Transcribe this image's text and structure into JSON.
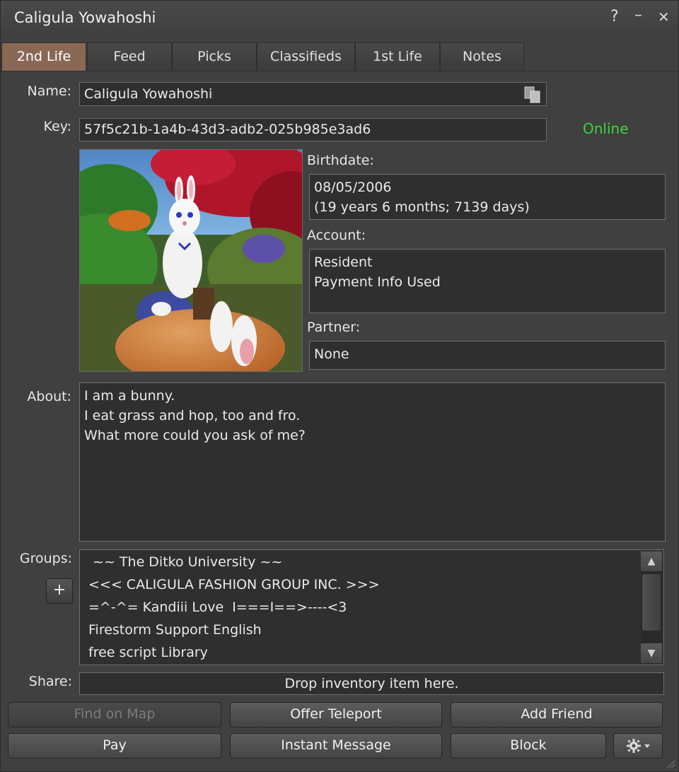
{
  "window": {
    "title": "Caligula Yowahoshi",
    "help": "?",
    "minimize": "–",
    "close": "✕"
  },
  "tabs": [
    {
      "label": "2nd Life",
      "active": true
    },
    {
      "label": "Feed"
    },
    {
      "label": "Picks"
    },
    {
      "label": "Classifieds"
    },
    {
      "label": "1st Life"
    },
    {
      "label": "Notes"
    }
  ],
  "profile": {
    "name_label": "Name:",
    "name": "Caligula Yowahoshi",
    "key_label": "Key:",
    "key": "57f5c21b-1a4b-43d3-adb2-025b985e3ad6",
    "status": "Online",
    "status_color": "#3ad63a",
    "birthdate_label": "Birthdate:",
    "birthdate": "08/05/2006",
    "birthdate_detail": "(19 years 6 months; 7139 days)",
    "account_label": "Account:",
    "account_type": "Resident",
    "account_payment": "Payment Info Used",
    "partner_label": "Partner:",
    "partner": "None",
    "about_label": "About:",
    "about_lines": [
      "I am a bunny.",
      "I eat grass and hop, too and fro.",
      "What more could you ask of me?"
    ],
    "groups_label": "Groups:",
    "groups": [
      " ~~ The Ditko University ~~",
      "<<< CALIGULA FASHION GROUP INC. >>>",
      "=^-^= Kandiii Love  I===I==>----<3",
      "Firestorm Support English",
      "free script Library"
    ],
    "add_group": "+",
    "share_label": "Share:",
    "share_drop": "Drop inventory item here."
  },
  "buttons": {
    "find_on_map": "Find on Map",
    "offer_teleport": "Offer Teleport",
    "add_friend": "Add Friend",
    "pay": "Pay",
    "instant_message": "Instant Message",
    "block": "Block"
  },
  "colors": {
    "active_tab": "#8a6856",
    "background": "#404040"
  }
}
